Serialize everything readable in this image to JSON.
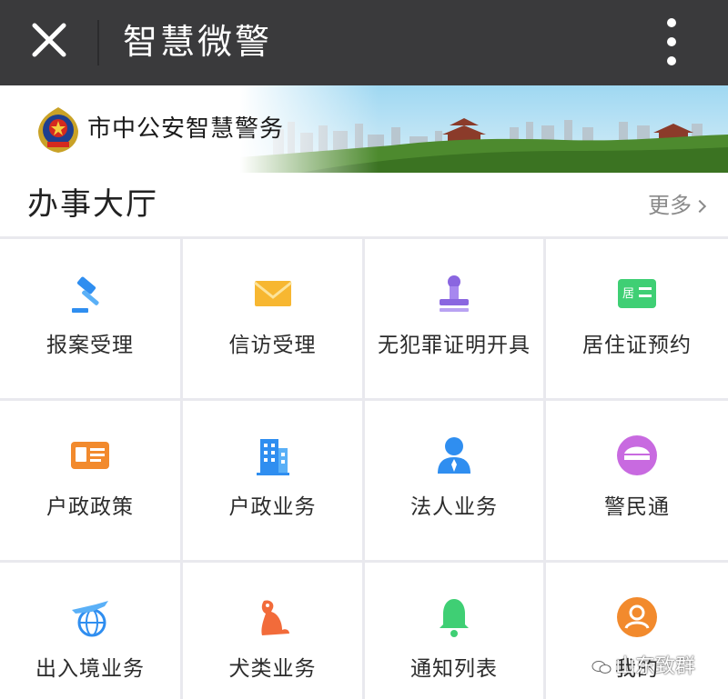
{
  "header": {
    "title": "智慧微警"
  },
  "banner": {
    "org_name": "市中公安智慧警务"
  },
  "section": {
    "title": "办事大厅",
    "more_label": "更多"
  },
  "services": [
    {
      "label": "报案受理",
      "icon": "gavel-icon"
    },
    {
      "label": "信访受理",
      "icon": "envelope-icon"
    },
    {
      "label": "无犯罪证明开具",
      "icon": "stamp-icon"
    },
    {
      "label": "居住证预约",
      "icon": "residence-card-icon"
    },
    {
      "label": "户政政策",
      "icon": "id-card-icon"
    },
    {
      "label": "户政业务",
      "icon": "building-icon"
    },
    {
      "label": "法人业务",
      "icon": "person-icon"
    },
    {
      "label": "警民通",
      "icon": "police-cap-icon"
    },
    {
      "label": "出入境业务",
      "icon": "airplane-globe-icon"
    },
    {
      "label": "犬类业务",
      "icon": "dog-icon"
    },
    {
      "label": "通知列表",
      "icon": "bell-icon"
    },
    {
      "label": "我的",
      "icon": "user-avatar-icon"
    }
  ],
  "watermark": {
    "text": "山东致群"
  },
  "colors": {
    "topbar": "#3a3a3c",
    "grid_line": "#e9e9ee",
    "blue": "#2f8ef0",
    "orange": "#f28a2d",
    "purple": "#8a66e0",
    "green": "#3fcf74"
  }
}
